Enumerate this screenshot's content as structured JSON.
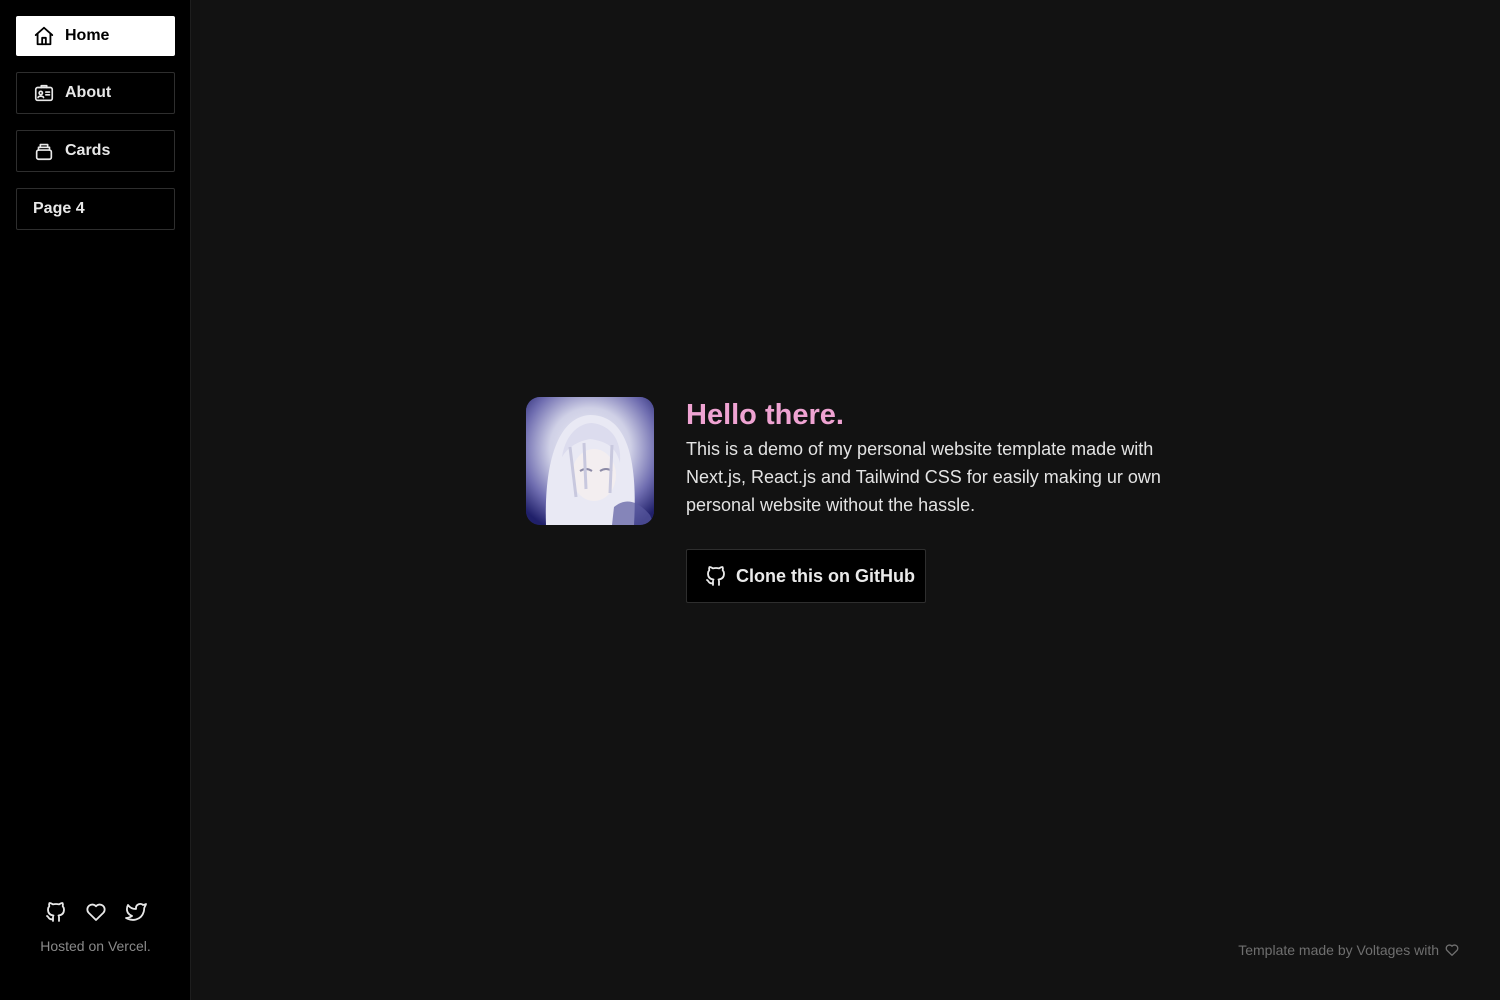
{
  "sidebar": {
    "items": [
      {
        "label": "Home",
        "icon": "home-icon",
        "active": true
      },
      {
        "label": "About",
        "icon": "id-card-icon",
        "active": false
      },
      {
        "label": "Cards",
        "icon": "cards-stack-icon",
        "active": false
      },
      {
        "label": "Page 4",
        "icon": "",
        "active": false
      }
    ],
    "social_icons": [
      "github-icon",
      "heart-icon",
      "twitter-icon"
    ],
    "hosted_text": "Hosted on Vercel."
  },
  "main": {
    "headline": "Hello there.",
    "description": "This is a demo of my personal website template made with Next.js, React.js and Tailwind CSS for easily making ur own personal website without the hassle.",
    "clone_button_label": "Clone this on GitHub",
    "credit_text": "Template made by Voltages with"
  },
  "colors": {
    "accent": "#efa3d2",
    "sidebar_bg": "#000000",
    "main_bg": "#121212"
  }
}
